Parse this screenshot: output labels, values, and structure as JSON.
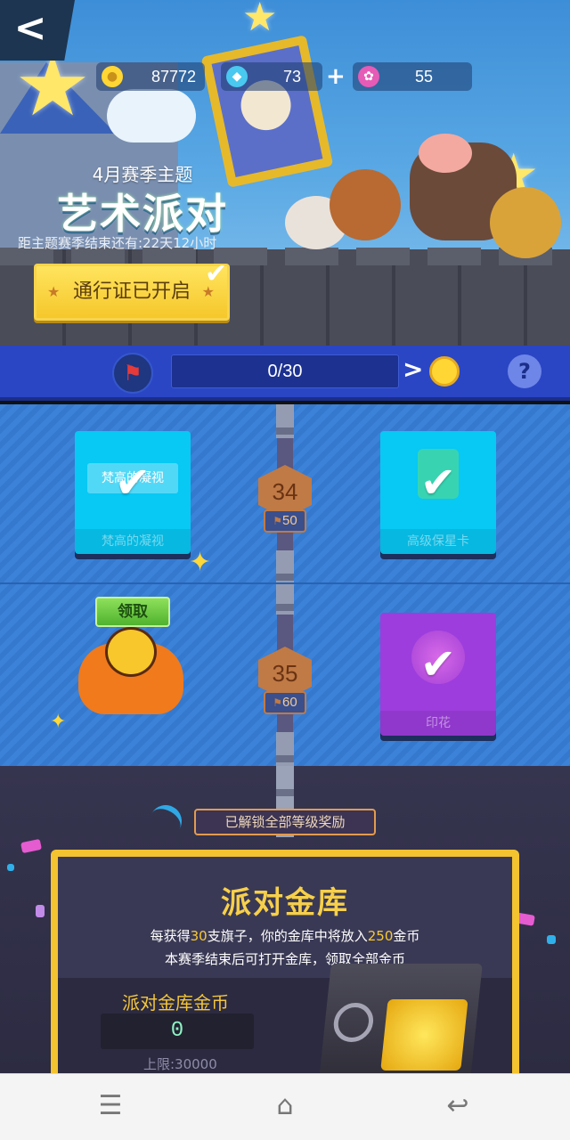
{
  "header": {
    "back_label": "<",
    "currencies": [
      {
        "name": "coins",
        "value": "87772",
        "color": "#ffd633"
      },
      {
        "name": "gems",
        "value": "73",
        "color": "#49c8f0"
      },
      {
        "name": "stamps",
        "value": "55",
        "color": "#e65bb6"
      }
    ],
    "add_label": "+",
    "season_subtitle": "4月赛季主题",
    "season_title": "艺术派对",
    "season_countdown": "距主题赛季结束还有:22天12小时",
    "pass_button": "通行证已开启",
    "pass_check": "✔"
  },
  "progress": {
    "text": "0/30",
    "value": 0,
    "max": 30,
    "flag_icon": "⚑",
    "next_arrow": ">",
    "help_label": "?"
  },
  "levels": [
    {
      "number": "34",
      "flags_required": "50",
      "left_reward": {
        "inner_label": "梵高的凝视",
        "label": "梵高的凝视",
        "claimed": true
      },
      "right_reward": {
        "label": "高级保星卡",
        "claimed": true
      }
    },
    {
      "number": "35",
      "flags_required": "60",
      "left_reward": {
        "claim_label": "领取"
      },
      "right_reward": {
        "label": "印花",
        "claimed": true
      }
    }
  ],
  "vault": {
    "unlocked_all_label": "已解锁全部等级奖励",
    "title": "派对金库",
    "desc_line1_a": "每获得",
    "desc_line1_flags": "30",
    "desc_line1_b": "支旗子，你的金库中将放入",
    "desc_line1_coins": "250",
    "desc_line1_c": "金币",
    "desc_line2": "本赛季结束后可打开金库，领取全部金币",
    "coins_label": "派对金库金币",
    "coins_amount": "0",
    "limit": "上限:30000"
  },
  "navbar": {
    "menu_icon": "☰",
    "home_icon": "⌂",
    "back_icon": "↩"
  },
  "colors": {
    "accent_gold": "#f3c330",
    "progress_bg": "#2a46c4",
    "card_cyan": "#08c8f4",
    "card_purple": "#9d3ddd"
  }
}
